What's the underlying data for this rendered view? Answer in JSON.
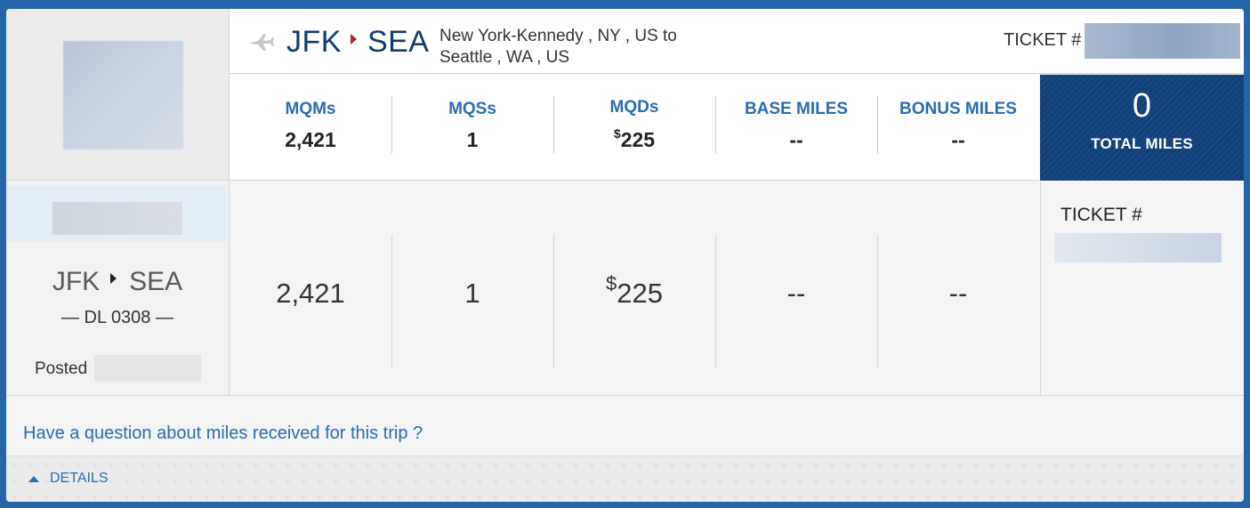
{
  "header": {
    "origin": "JFK",
    "destination": "SEA",
    "route_line1": "New York-Kennedy , NY , US to",
    "route_line2": "Seattle , WA , US",
    "ticket_label": "TICKET #",
    "plane_icon": "plane-icon"
  },
  "stats": [
    {
      "label": "MQMs",
      "value": "2,421"
    },
    {
      "label": "MQSs",
      "value": "1"
    },
    {
      "label": "MQDs",
      "currency": "$",
      "value": "225"
    },
    {
      "label": "BASE MILES",
      "value": "--"
    },
    {
      "label": "BONUS MILES",
      "value": "--"
    }
  ],
  "total": {
    "value": "0",
    "label": "TOTAL MILES"
  },
  "segment": {
    "origin": "JFK",
    "destination": "SEA",
    "flight": "— DL 0308 —",
    "posted_label": "Posted",
    "values": [
      "2,421",
      "1",
      "225",
      "--",
      "--"
    ],
    "currency": "$",
    "ticket_label": "TICKET #"
  },
  "question_link": "Have a question about miles received for this trip ?",
  "details_label": "DETAILS",
  "colors": {
    "accent": "#2b6cb4",
    "navy": "#123a70",
    "arrow_red": "#c01933",
    "frame": "#2565a7"
  }
}
